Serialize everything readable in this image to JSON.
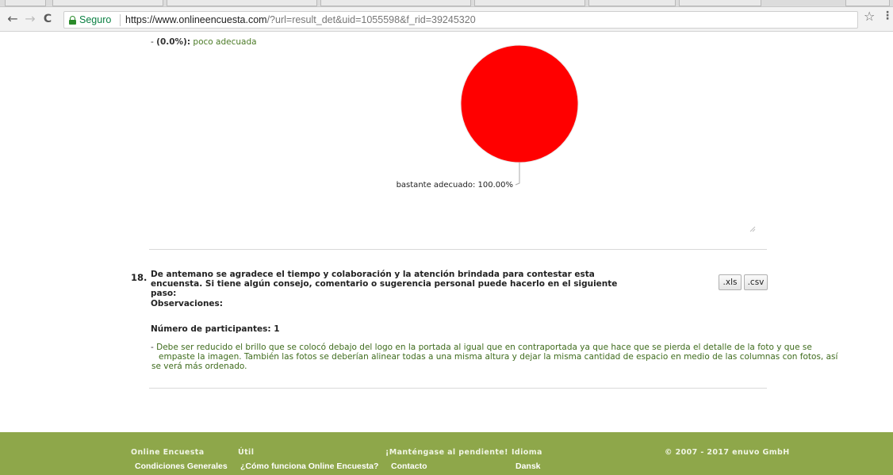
{
  "browser": {
    "secure_label": "Seguro",
    "url_scheme": "https://",
    "url_host": "www.onlineencuesta.com",
    "url_path": "/?url=result_det&uid=1055598&f_rid=39245320",
    "back_glyph": "←",
    "forward_glyph": "→",
    "reload_glyph": "C",
    "star_glyph": "☆",
    "menu_glyph": "⋮"
  },
  "previous_item": {
    "prefix": "- ",
    "percent": "(0.0%):",
    "answer": "poco adecuada"
  },
  "chart_data": {
    "type": "pie",
    "title": "",
    "slices": [
      {
        "label": "bastante adecuado",
        "value": 100.0,
        "color": "#ff0000"
      }
    ],
    "data_labels": [
      "bastante adecuado: 100.00%"
    ]
  },
  "question": {
    "number": "18.",
    "text": "De antemano se agradece el tiempo y colaboración y la atención brindada para contestar esta encuensta. Si tiene algún consejo, comentario o sugerencia personal puede hacerlo en el siguiente paso:",
    "export_xls": ".xls",
    "export_csv": ".csv",
    "observations_label": "Observaciones:",
    "participants_label": "Número de participantes: 1",
    "response_dash": "- ",
    "response_lines": [
      "Debe ser reducido el brillo que se colocó debajo del logo en la portada al igual que en contraportada ya que hace que se pierda el detalle de la foto y que se",
      "empaste la imagen. También las fotos se deberían alinear todas a una misma altura y dejar la misma cantidad de espacio en medio de las columnas con fotos, así",
      "se verá más ordenado."
    ]
  },
  "footer": {
    "columns": [
      {
        "heading": "Online Encuesta",
        "link": "Condiciones Generales"
      },
      {
        "heading": "Útil",
        "link": "¿Cómo funciona Online Encuesta?"
      },
      {
        "heading": "¡Manténgase al pendiente!",
        "link": "Contacto"
      },
      {
        "heading": "Idioma",
        "link": "Dansk"
      }
    ],
    "copyright": "© 2007 - 2017 enuvo GmbH"
  },
  "colors": {
    "footer_bg": "#8ea74a",
    "answer_green": "#4b7a26",
    "pie_red": "#ff0000"
  }
}
